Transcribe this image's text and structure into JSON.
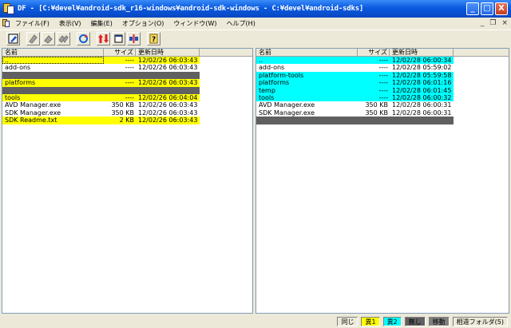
{
  "window": {
    "title": "DF - [C:¥devel¥android-sdk_r16-windows¥android-sdk-windows  -  C:¥devel¥android-sdks]",
    "controls": {
      "minimize": "_",
      "maximize": "□",
      "close": "X"
    }
  },
  "menu": {
    "items": [
      "ファイル(F)",
      "表示(V)",
      "編集(E)",
      "オプション(O)",
      "ウィンドウ(W)",
      "ヘルプ(H)"
    ],
    "mdi_controls": [
      "_",
      "❐",
      "×"
    ]
  },
  "toolbar": {
    "buttons": [
      "edit-icon",
      "copy-left-icon",
      "copy-right-icon",
      "copy-both-icon",
      "refresh-icon",
      "sync-up-down-icon",
      "window-icon",
      "split-compare-icon",
      "help-icon"
    ]
  },
  "columns": {
    "name": "名前",
    "size": "サイズ",
    "date": "更新日時"
  },
  "left_pane": {
    "rows": [
      {
        "name": "..",
        "size": "----",
        "date": "12/02/26 06:03:43",
        "color": "yellow"
      },
      {
        "name": "add-ons",
        "size": "----",
        "date": "12/02/26 06:03:43",
        "color": "white"
      },
      {
        "name": "",
        "size": "",
        "date": "",
        "color": "gray"
      },
      {
        "name": "platforms",
        "size": "----",
        "date": "12/02/26 06:03:43",
        "color": "yellow"
      },
      {
        "name": "",
        "size": "",
        "date": "",
        "color": "gray"
      },
      {
        "name": "tools",
        "size": "----",
        "date": "12/02/26 06:04:04",
        "color": "yellow"
      },
      {
        "name": "AVD Manager.exe",
        "size": "350 KB",
        "date": "12/02/26 06:03:43",
        "color": "white"
      },
      {
        "name": "SDK Manager.exe",
        "size": "350 KB",
        "date": "12/02/26 06:03:43",
        "color": "white"
      },
      {
        "name": "SDK Readme.txt",
        "size": "2 KB",
        "date": "12/02/26 06:03:43",
        "color": "yellow"
      }
    ]
  },
  "right_pane": {
    "rows": [
      {
        "name": "..",
        "size": "----",
        "date": "12/02/28 06:00:34",
        "color": "cyan"
      },
      {
        "name": "add-ons",
        "size": "----",
        "date": "12/02/28 05:59:02",
        "color": "white"
      },
      {
        "name": "platform-tools",
        "size": "----",
        "date": "12/02/28 05:59:58",
        "color": "cyan"
      },
      {
        "name": "platforms",
        "size": "----",
        "date": "12/02/28 06:01:16",
        "color": "cyan"
      },
      {
        "name": "temp",
        "size": "----",
        "date": "12/02/28 06:01:45",
        "color": "cyan"
      },
      {
        "name": "tools",
        "size": "----",
        "date": "12/02/28 06:00:32",
        "color": "cyan"
      },
      {
        "name": "AVD Manager.exe",
        "size": "350 KB",
        "date": "12/02/28 06:00:31",
        "color": "white"
      },
      {
        "name": "SDK Manager.exe",
        "size": "350 KB",
        "date": "12/02/28 06:00:31",
        "color": "white"
      },
      {
        "name": "",
        "size": "",
        "date": "",
        "color": "gray"
      }
    ]
  },
  "status": {
    "legend": [
      {
        "label": "同じ",
        "bg": "#ece9d8",
        "fg": "#000000"
      },
      {
        "label": "異1",
        "bg": "#ffff00",
        "fg": "#000000"
      },
      {
        "label": "異2",
        "bg": "#00ffff",
        "fg": "#000000"
      },
      {
        "label": "無し",
        "bg": "#606060",
        "fg": "#000000"
      },
      {
        "label": "移動",
        "bg": "#808080",
        "fg": "#000000"
      },
      {
        "label": "相違フォルダ(5)",
        "bg": "#ece9d8",
        "fg": "#000000"
      }
    ]
  }
}
